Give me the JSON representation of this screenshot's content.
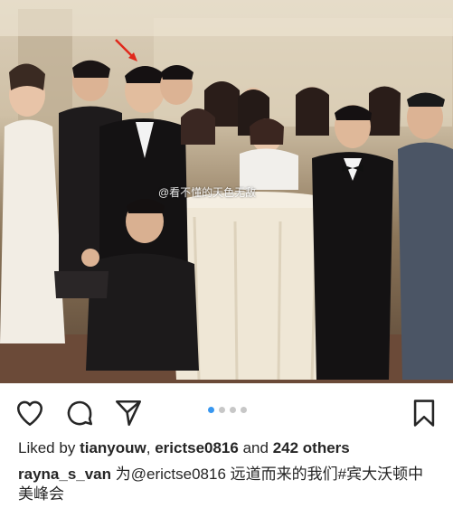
{
  "post": {
    "watermark": "@看不懂的天色无敌",
    "carousel": {
      "count": 4,
      "active_index": 0
    },
    "likes": {
      "prefix": "Liked by",
      "user1": "tianyouw",
      "separator": ",",
      "user2": "erictse0816",
      "and_text": "and",
      "others": "242 others"
    },
    "caption": {
      "username": "rayna_s_van",
      "text": "为@erictse0816 远道而来的我们#宾大沃顿中美峰会"
    }
  },
  "icons": {
    "like": "heart-icon",
    "comment": "comment-icon",
    "share": "send-icon",
    "save": "bookmark-icon",
    "annotation": "red-arrow-icon"
  },
  "colors": {
    "accent_dot": "#3897f0",
    "inactive_dot": "#c7c7c7",
    "arrow": "#e0281c"
  }
}
